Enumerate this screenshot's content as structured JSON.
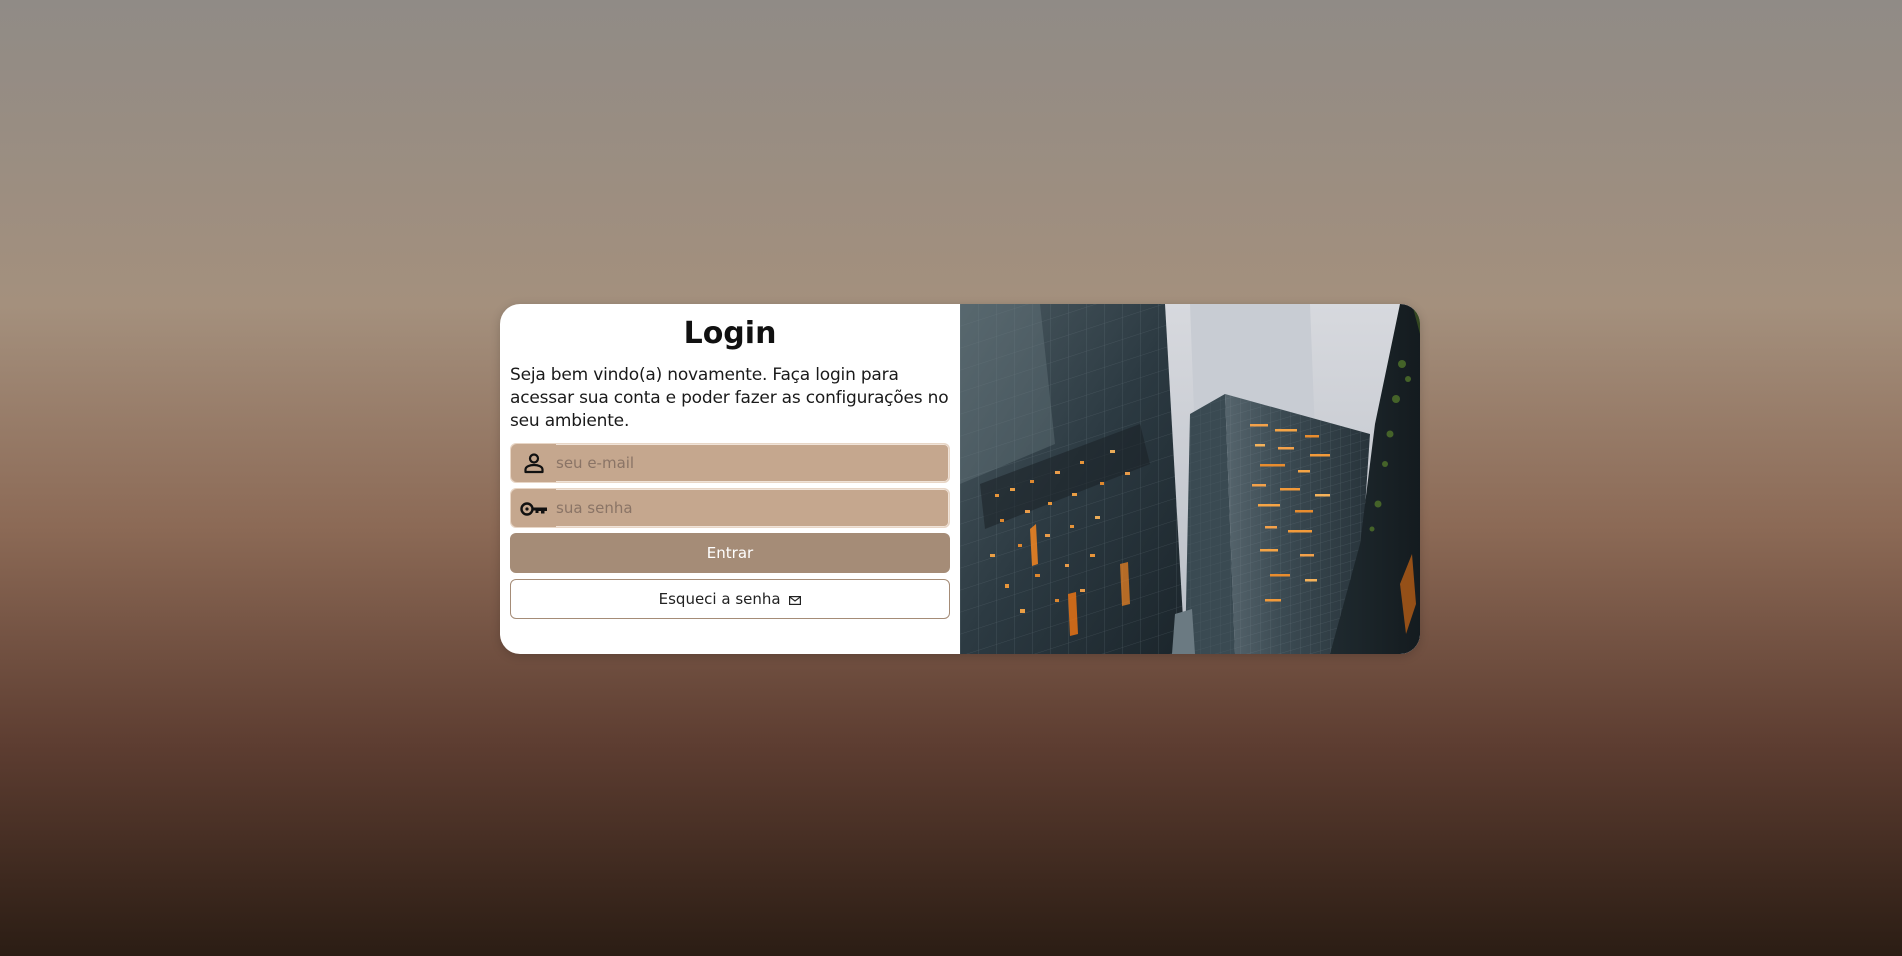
{
  "login": {
    "title": "Login",
    "subtitle": "Seja bem vindo(a) novamente. Faça login para acessar sua conta e poder fazer as configurações no seu ambiente.",
    "email": {
      "icon": "user-icon",
      "placeholder": "seu e-mail",
      "value": ""
    },
    "password": {
      "icon": "key-icon",
      "placeholder": "sua senha",
      "value": ""
    },
    "submit_label": "Entrar",
    "forgot_label": "Esqueci a senha",
    "forgot_icon": "mail-icon"
  },
  "colors": {
    "input_bg": "#c5a78e",
    "button_bg": "#a58c77",
    "card_bg": "#ffffff"
  }
}
